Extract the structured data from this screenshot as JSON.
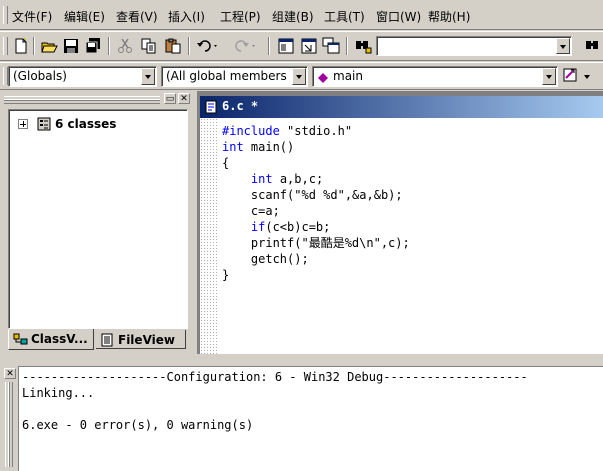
{
  "menu": {
    "items": [
      "文件(F)",
      "编辑(E)",
      "查看(V)",
      "插入(I)",
      "工程(P)",
      "组建(B)",
      "工具(T)",
      "窗口(W)",
      "帮助(H)"
    ]
  },
  "toolbar": {
    "find_combo_value": ""
  },
  "wizardbar": {
    "class_combo": "(Globals)",
    "filter_combo": "(All global members",
    "member_combo": "main"
  },
  "workspace": {
    "tree_root": "6 classes",
    "tabs": [
      {
        "label": "ClassV...",
        "active": true
      },
      {
        "label": "FileView",
        "active": false
      }
    ]
  },
  "editor": {
    "title": "6.c *",
    "lines": [
      {
        "kw": "#include",
        "rest": " \"stdio.h\""
      },
      {
        "kw": "int",
        "rest": " main()"
      },
      {
        "kw": "",
        "rest": "{"
      },
      {
        "kw": "",
        "rest": "    ",
        "kw2": "int",
        "rest2": " a,b,c;"
      },
      {
        "kw": "",
        "rest": "    scanf(\"%d %d\",&a,&b);"
      },
      {
        "kw": "",
        "rest": "    c=a;"
      },
      {
        "kw": "",
        "rest": "    ",
        "kw2": "if",
        "rest2": "(c<b)c=b;"
      },
      {
        "kw": "",
        "rest": "    printf(\"最酷是%d\\n\",c);"
      },
      {
        "kw": "",
        "rest": "    getch();"
      },
      {
        "kw": "",
        "rest": "}"
      }
    ]
  },
  "output": {
    "lines": [
      "--------------------Configuration: 6 - Win32 Debug--------------------",
      "Linking...",
      "",
      "6.exe - 0 error(s), 0 warning(s)"
    ]
  },
  "colors": {
    "face": "#d4d0c8",
    "title_start": "#0a246a",
    "title_end": "#a6caf0",
    "keyword": "#0000ff"
  }
}
